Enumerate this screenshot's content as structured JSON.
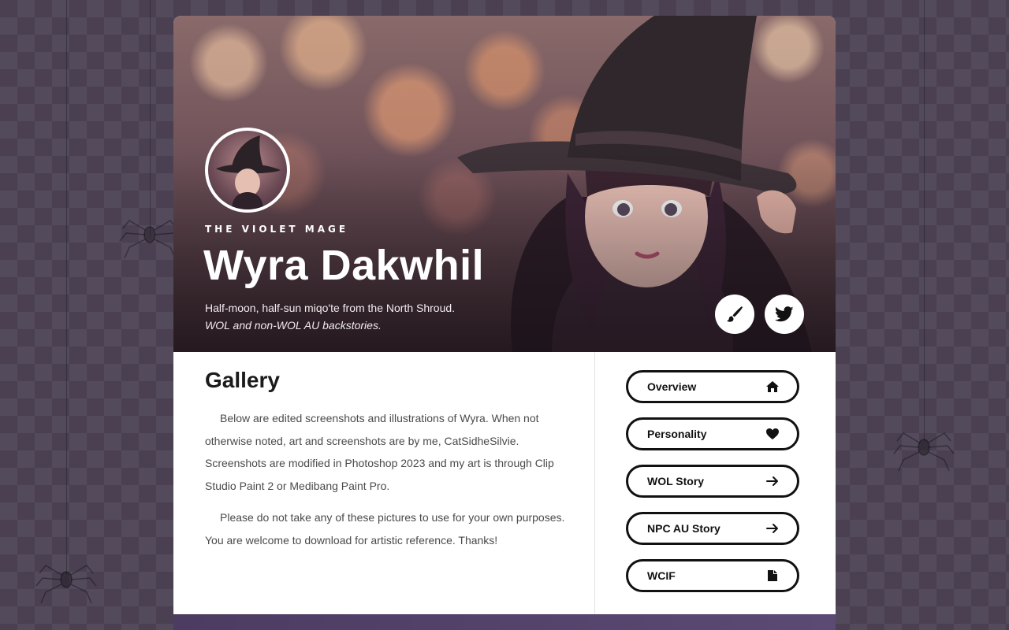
{
  "hero": {
    "eyebrow": "THE VIOLET MAGE",
    "title": "Wyra Dakwhil",
    "subtitle": "Half-moon, half-sun miqo'te from the North Shroud.",
    "subtitle_italic": "WOL and non-WOL AU backstories.",
    "social": [
      {
        "icon": "paintbrush-icon"
      },
      {
        "icon": "twitter-icon"
      }
    ]
  },
  "main": {
    "section_title": "Gallery",
    "paragraphs": [
      "Below are edited screenshots and illustrations of Wyra. When not otherwise noted, art and screenshots are by me, CatSidheSilvie. Screenshots are modified in Photoshop 2023 and my art is through Clip Studio Paint 2 or Medibang Paint Pro.",
      "Please do not take any of these pictures to use for your own purposes. You are welcome to download for artistic reference. Thanks!"
    ]
  },
  "nav": {
    "items": [
      {
        "label": "Overview",
        "icon": "home-icon"
      },
      {
        "label": "Personality",
        "icon": "heart-icon"
      },
      {
        "label": "WOL Story",
        "icon": "arrow-right-icon"
      },
      {
        "label": "NPC AU Story",
        "icon": "arrow-right-icon"
      },
      {
        "label": "WCIF",
        "icon": "file-icon"
      }
    ]
  },
  "colors": {
    "background": "#4a4052",
    "card": "#ffffff",
    "button_border": "#111111",
    "footer_band": "#4c3c62"
  }
}
